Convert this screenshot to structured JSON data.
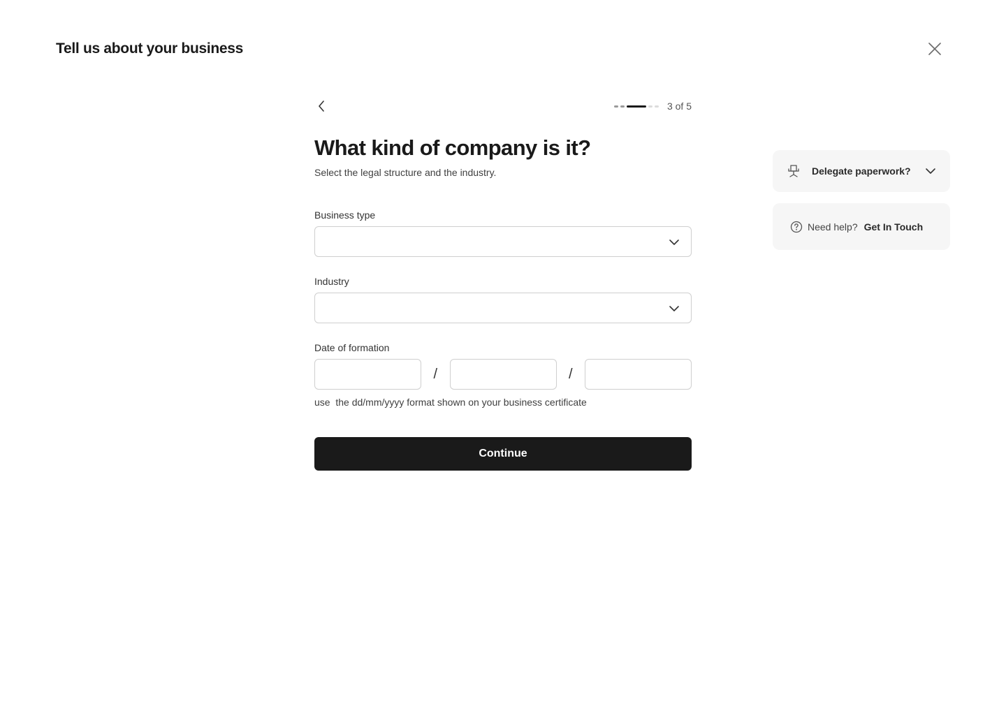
{
  "header": {
    "title": "Tell us about your business",
    "close_icon": "close-icon"
  },
  "progress": {
    "current_step": 3,
    "total_steps": 5,
    "label": "3 of 5",
    "back_icon": "chevron-left-icon"
  },
  "main": {
    "question": "What kind of company is it?",
    "subtitle": "Select the legal structure and the industry."
  },
  "fields": {
    "business_type": {
      "label": "Business type",
      "value": "",
      "icon": "chevron-down-icon"
    },
    "industry": {
      "label": "Industry",
      "value": "",
      "icon": "chevron-down-icon"
    },
    "date_of_formation": {
      "label": "Date of formation",
      "day": "",
      "month": "",
      "year": "",
      "separator": "/",
      "hint": "use  the dd/mm/yyyy format shown on your business certificate"
    }
  },
  "actions": {
    "continue_label": "Continue"
  },
  "sidebar": {
    "delegate": {
      "label": "Delegate paperwork?",
      "icon": "office-chair-icon",
      "chevron_icon": "chevron-down-icon"
    },
    "help": {
      "text": "Need help?",
      "link_label": "Get In Touch",
      "icon": "question-circle-icon"
    }
  },
  "colors": {
    "primary": "#1a1a1a",
    "background": "#ffffff",
    "card_background": "#f6f6f6",
    "border": "#cfcfcf",
    "progress_inactive": "#dcdcdc"
  }
}
